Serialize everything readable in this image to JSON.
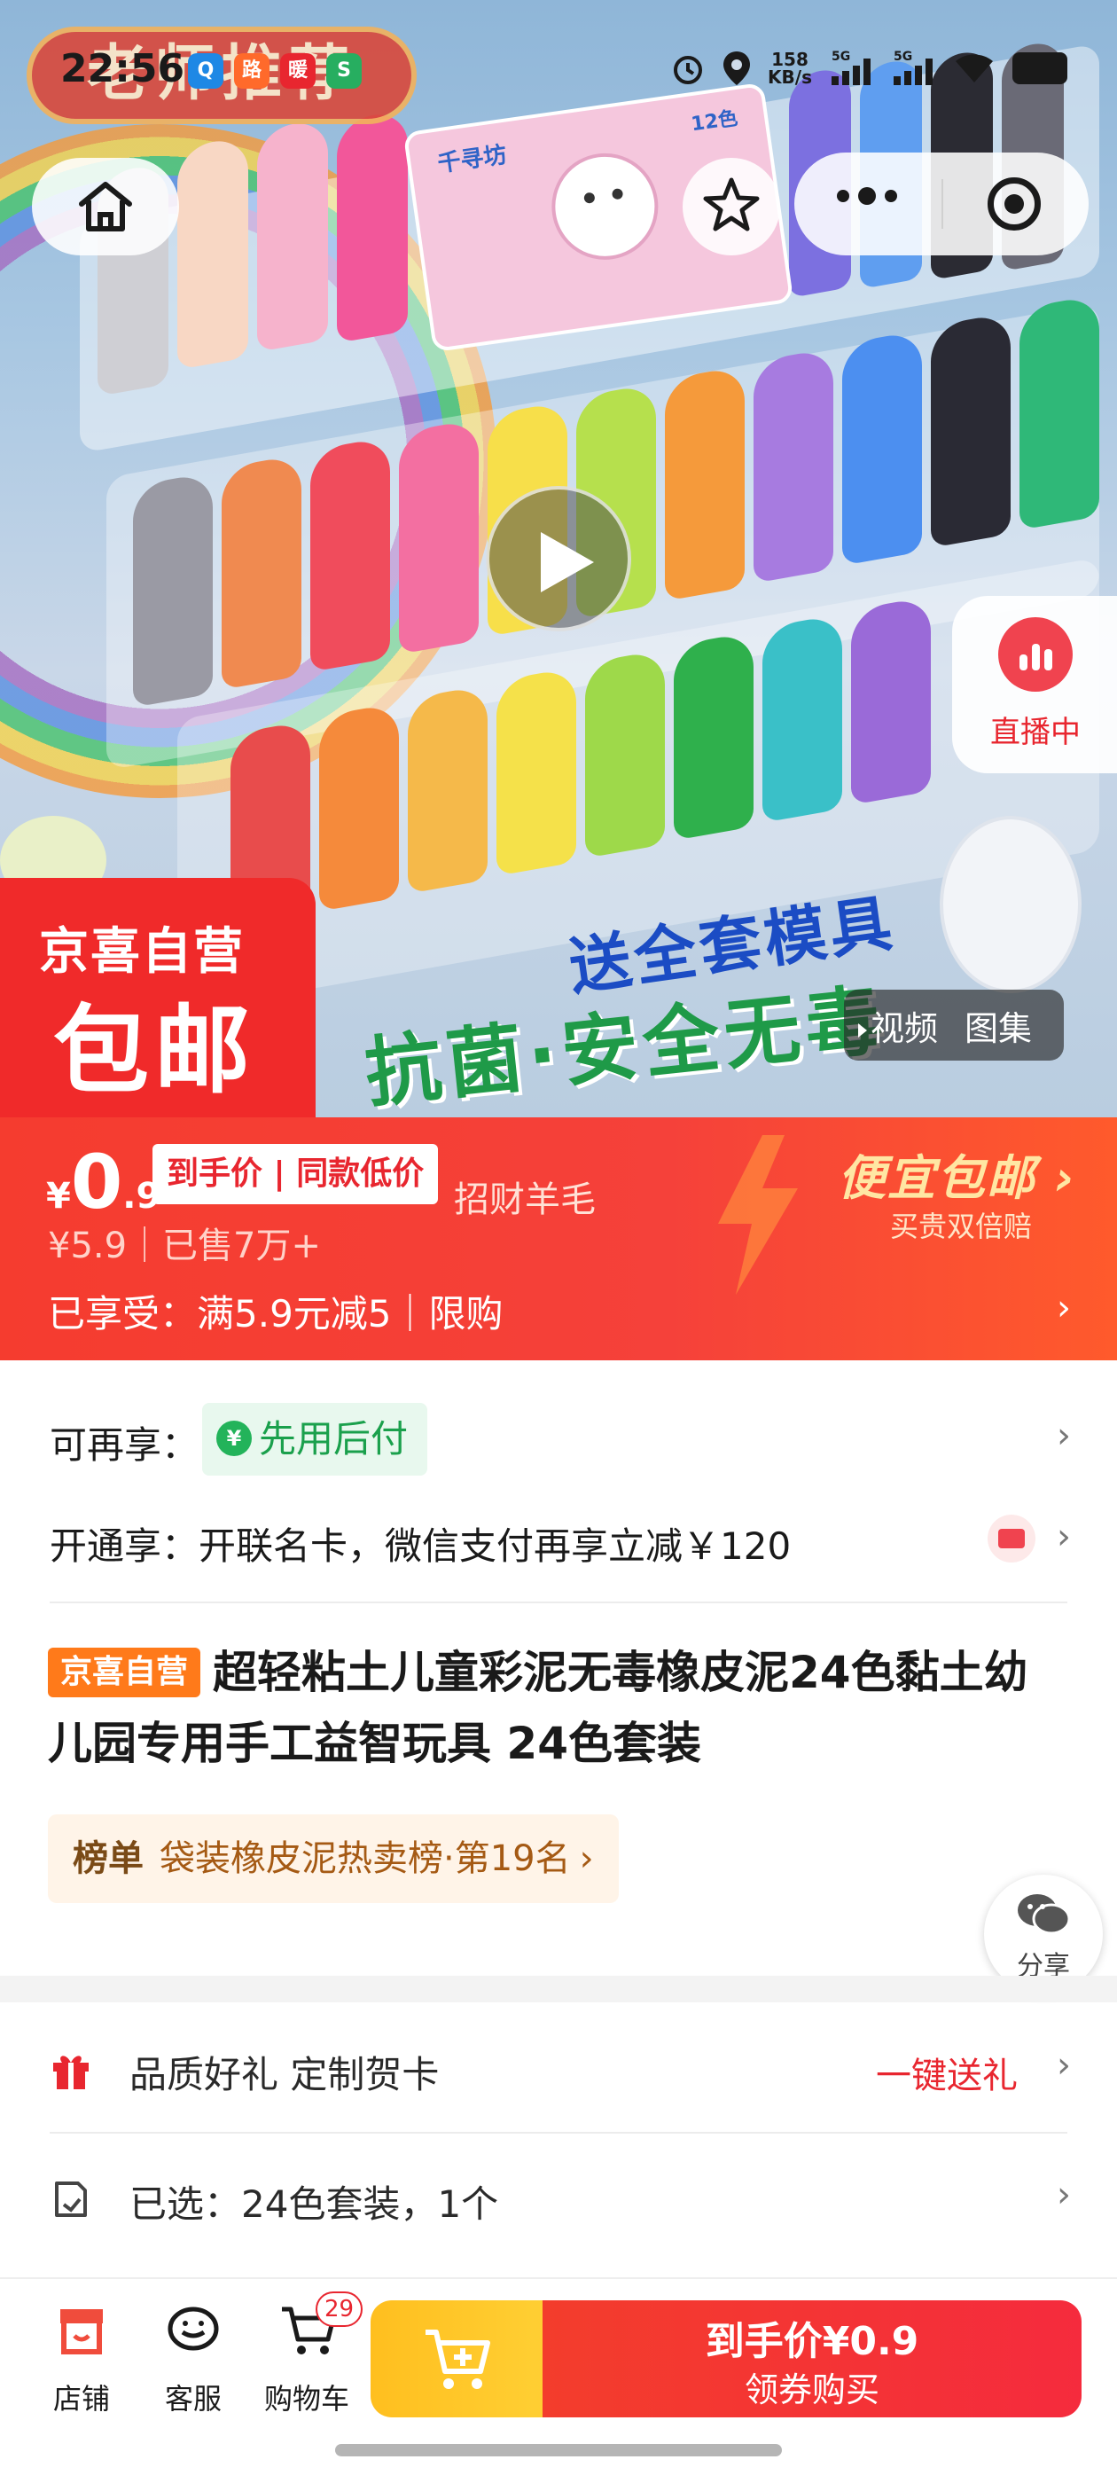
{
  "status_bar": {
    "time": "22:56",
    "app_badges": [
      "Q",
      "路",
      "暖",
      "S"
    ],
    "net_speed_value": "158",
    "net_speed_unit": "KB/s",
    "signal_1": "5G",
    "signal_2": "5G"
  },
  "hero": {
    "banner_text": "老师推荐",
    "package_brand": "千寻坊",
    "package_count": "12色",
    "corner_line1": "京喜自营",
    "corner_line2": "包邮",
    "promo_line1": "送全套模具",
    "promo_line2": "抗菌·安全无毒",
    "media_video": "视频",
    "media_gallery": "图集",
    "live_label": "直播中"
  },
  "price": {
    "currency": "¥",
    "integer": "0",
    "decimal": ".9",
    "tag": "到手价 | 同款低价",
    "wool": "招财羊毛",
    "original": "¥5.9｜已售7万+",
    "enjoyed": "已享受：满5.9元减5｜限购",
    "cheap_title": "便宜包邮",
    "cheap_sub": "买贵双倍赔"
  },
  "services": {
    "enjoy_label": "可再享：",
    "pay_later": "先用后付",
    "card_text": "开通享：开联名卡，微信支付再享立减￥120"
  },
  "product": {
    "tag": "京喜自营",
    "title": "超轻粘土儿童彩泥无毒橡皮泥24色黏土幼儿园专用手工益智玩具 24色套装",
    "rank_label": "榜单",
    "rank_text": "袋装橡皮泥热卖榜·第19名",
    "share_label": "分享"
  },
  "options": {
    "gift_text": "品质好礼 定制贺卡",
    "gift_action": "一键送礼",
    "selected_text": "已选：24色套装，1个"
  },
  "bottom_bar": {
    "store": "店铺",
    "service": "客服",
    "cart": "购物车",
    "cart_count": "29",
    "buy_line1": "到手价¥0.9",
    "buy_line2": "领券购买"
  },
  "colors": {
    "accent_red": "#f53c2f",
    "pay_green": "#1aa04c",
    "cart_yellow": "#ffc21f",
    "jx_orange": "#ff7a1a"
  }
}
